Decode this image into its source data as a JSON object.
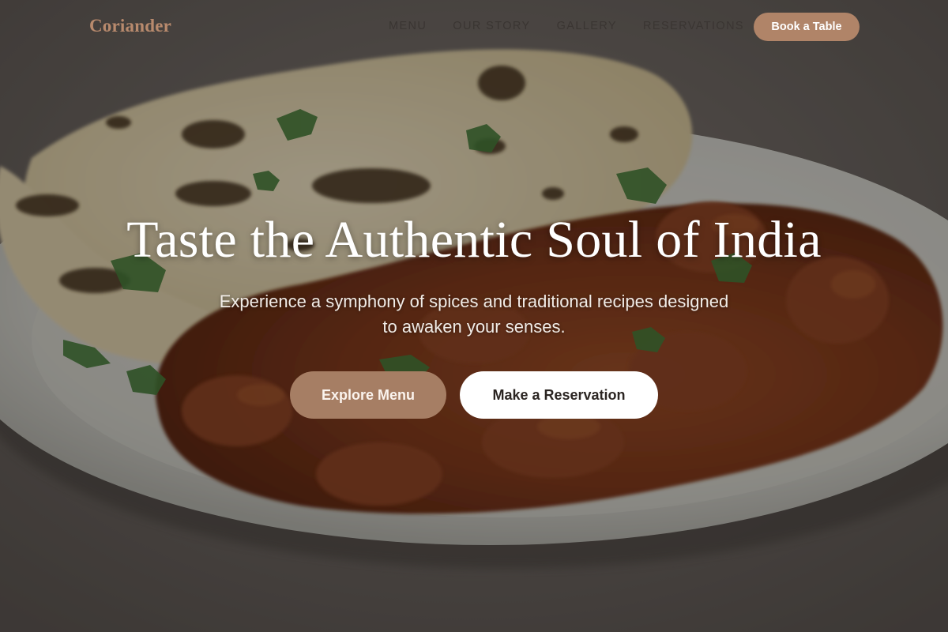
{
  "brand": {
    "name": "Coriander",
    "color": "#b88a6d"
  },
  "nav": {
    "links": [
      {
        "label": "MENU"
      },
      {
        "label": "OUR STORY"
      },
      {
        "label": "GALLERY"
      },
      {
        "label": "RESERVATIONS"
      }
    ],
    "cta_label": "Book a Table",
    "cta_color": "#b08468"
  },
  "hero": {
    "title": "Taste the Authentic Soul of India",
    "subtitle": "Experience a symphony of spices and traditional recipes designed to awaken your senses.",
    "primary_button": "Explore Menu",
    "secondary_button": "Make a Reservation",
    "primary_color": "#a67e64",
    "secondary_color": "#ffffff",
    "image": "curry-and-naan-photo"
  }
}
